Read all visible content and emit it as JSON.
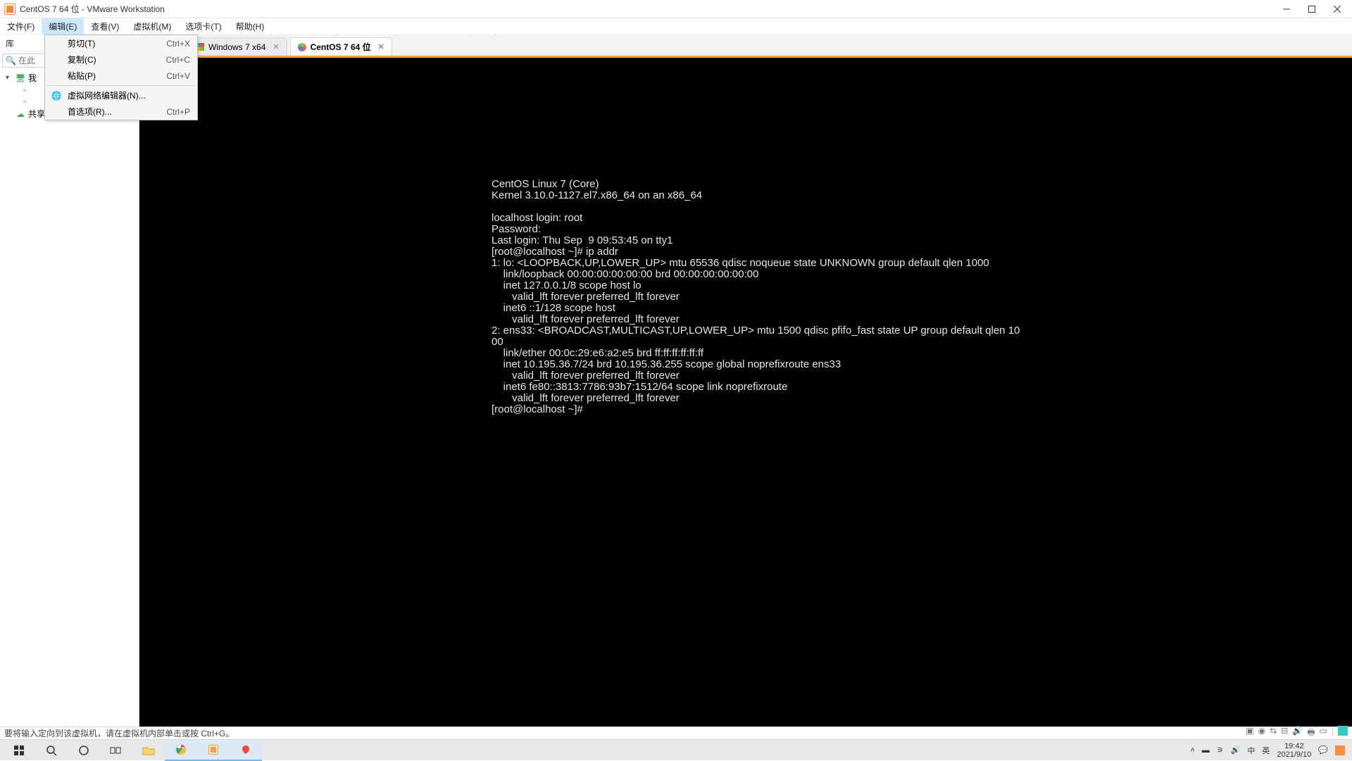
{
  "titlebar": {
    "title": "CentOS 7 64 位 - VMware Workstation"
  },
  "menubar": {
    "items": [
      "文件(F)",
      "编辑(E)",
      "查看(V)",
      "虚拟机(M)",
      "选项卡(T)",
      "帮助(H)"
    ],
    "active_index": 1
  },
  "edit_menu": {
    "cut": "剪切(T)",
    "cut_key": "Ctrl+X",
    "copy": "复制(C)",
    "copy_key": "Ctrl+C",
    "paste": "粘贴(P)",
    "paste_key": "Ctrl+V",
    "vnet": "虚拟网络编辑器(N)...",
    "prefs": "首选项(R)...",
    "prefs_key": "Ctrl+P"
  },
  "sidebar": {
    "header": "库",
    "search_placeholder": "在此",
    "tree": {
      "root": "我",
      "shared": "共享的虚拟机"
    }
  },
  "tabs": {
    "win7": "Windows 7 x64",
    "centos": "CentOS 7 64 位"
  },
  "console_lines": [
    "CentOS Linux 7 (Core)",
    "Kernel 3.10.0-1127.el7.x86_64 on an x86_64",
    "",
    "localhost login: root",
    "Password:",
    "Last login: Thu Sep  9 09:53:45 on tty1",
    "[root@localhost ~]# ip addr",
    "1: lo: <LOOPBACK,UP,LOWER_UP> mtu 65536 qdisc noqueue state UNKNOWN group default qlen 1000",
    "    link/loopback 00:00:00:00:00:00 brd 00:00:00:00:00:00",
    "    inet 127.0.0.1/8 scope host lo",
    "       valid_lft forever preferred_lft forever",
    "    inet6 ::1/128 scope host",
    "       valid_lft forever preferred_lft forever",
    "2: ens33: <BROADCAST,MULTICAST,UP,LOWER_UP> mtu 1500 qdisc pfifo_fast state UP group default qlen 10",
    "00",
    "    link/ether 00:0c:29:e6:a2:e5 brd ff:ff:ff:ff:ff:ff",
    "    inet 10.195.36.7/24 brd 10.195.36.255 scope global noprefixroute ens33",
    "       valid_lft forever preferred_lft forever",
    "    inet6 fe80::3813:7786:93b7:1512/64 scope link noprefixroute",
    "       valid_lft forever preferred_lft forever",
    "[root@localhost ~]#"
  ],
  "statusbar": {
    "text": "要将输入定向到该虚拟机，请在虚拟机内部单击或按 Ctrl+G。"
  },
  "tray": {
    "ime1": "中",
    "ime2": "英",
    "time": "19:42",
    "date": "2021/9/10"
  }
}
